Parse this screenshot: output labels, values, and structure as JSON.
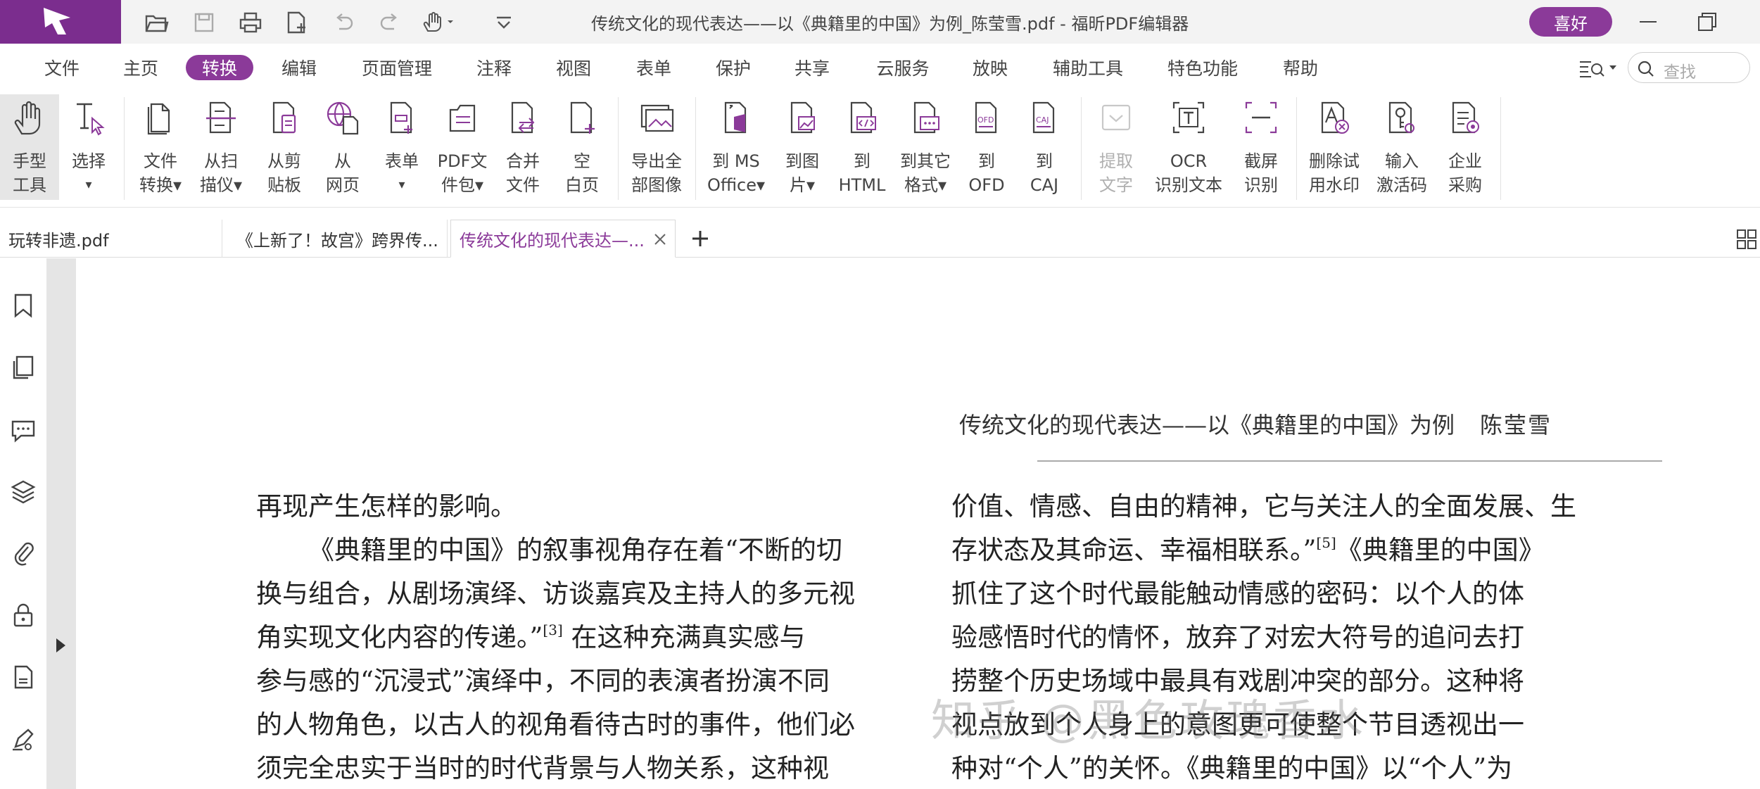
{
  "titlebar": {
    "title": "传统文化的现代表达——以《典籍里的中国》为例_陈莹雪.pdf - 福昕PDF编辑器",
    "vip_label": "喜好"
  },
  "menu": {
    "items": [
      "文件",
      "主页",
      "转换",
      "编辑",
      "页面管理",
      "注释",
      "视图",
      "表单",
      "保护",
      "共享",
      "云服务",
      "放映",
      "辅助工具",
      "特色功能",
      "帮助"
    ],
    "active": "转换",
    "search_placeholder": "查找"
  },
  "ribbon": {
    "tools": [
      {
        "label": "手型\n工具"
      },
      {
        "label": "选择"
      },
      {
        "label": "文件\n转换▾"
      },
      {
        "label": "从扫\n描仪▾"
      },
      {
        "label": "从剪\n贴板"
      },
      {
        "label": "从\n网页"
      },
      {
        "label": "表单"
      },
      {
        "label": "PDF文\n件包▾"
      },
      {
        "label": "合并\n文件"
      },
      {
        "label": "空\n白页"
      },
      {
        "label": "导出全\n部图像"
      },
      {
        "label": "到 MS\nOffice▾"
      },
      {
        "label": "到图\n片▾"
      },
      {
        "label": "到\nHTML"
      },
      {
        "label": "到其它\n格式▾"
      },
      {
        "label": "到\nOFD"
      },
      {
        "label": "到\nCAJ"
      },
      {
        "label": "提取\n文字"
      },
      {
        "label": "OCR\n识别文本"
      },
      {
        "label": "截屏\n识别"
      },
      {
        "label": "删除试\n用水印"
      },
      {
        "label": "输入\n激活码"
      },
      {
        "label": "企业\n采购"
      }
    ]
  },
  "tabs": [
    {
      "label": "玩转非遗.pdf"
    },
    {
      "label": "《上新了！故宫》跨界传..."
    },
    {
      "label": "传统文化的现代表达—..."
    }
  ],
  "document": {
    "running_header": "传统文化的现代表达——以《典籍里的中国》为例",
    "author": "陈莹雪",
    "left_column": [
      "再现产生怎样的影响。",
      "《典籍里的中国》的叙事视角存在着“不断的切",
      "换与组合，从剧场演绎、访谈嘉宾及主持人的多元视",
      "角实现文化内容的传递。”",
      "在这种充满真实感与",
      "参与感的“沉浸式”演绎中，不同的表演者扮演不同",
      "的人物角色，以古人的视角看待古时的事件，他们必",
      "须完全忠实于当时的时代背景与人物关系，这种视"
    ],
    "right_column": [
      "价值、情感、自由的精神，它与关注人的全面发展、生",
      "存状态及其命运、幸福相联系。”",
      "《典籍里的中国》",
      "抓住了这个时代最能触动情感的密码：以个人的体",
      "验感悟时代的情怀，放弃了对宏大符号的追问去打",
      "捞整个历史场域中最具有戏剧冲突的部分。这种将",
      "视点放到个人身上的意图更可使整个节目透视出一",
      "种对“个人”的关怀。《典籍里的中国》以“个人”为"
    ],
    "citation_left": "[3]",
    "citation_right": "[5]",
    "watermark": "知乎 @黑色玫瑰香水"
  }
}
